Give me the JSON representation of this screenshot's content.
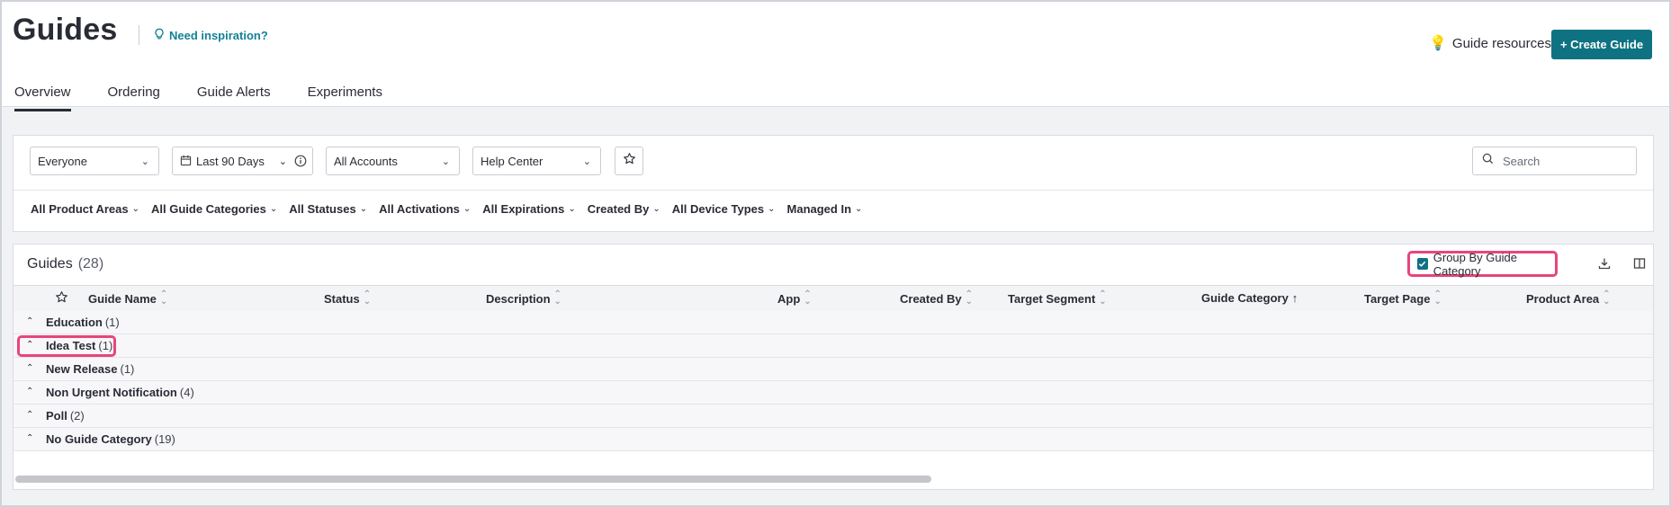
{
  "header": {
    "title": "Guides",
    "inspiration_label": "Need inspiration?",
    "resources_label": "Guide resources",
    "create_button_label": "+ Create Guide"
  },
  "tabs": [
    {
      "label": "Overview",
      "active": true
    },
    {
      "label": "Ordering",
      "active": false
    },
    {
      "label": "Guide Alerts",
      "active": false
    },
    {
      "label": "Experiments",
      "active": false
    }
  ],
  "filters": {
    "segment": "Everyone",
    "date_range": "Last 90 Days",
    "accounts": "All Accounts",
    "app": "Help Center",
    "search_placeholder": "Search",
    "more": [
      "All Product Areas",
      "All Guide Categories",
      "All Statuses",
      "All Activations",
      "All Expirations",
      "Created By",
      "All Device Types",
      "Managed In"
    ]
  },
  "grid": {
    "title": "Guides",
    "count": "(28)",
    "group_by_label": "Group By Guide Category",
    "group_by_checked": true,
    "columns": [
      "Guide Name",
      "Status",
      "Description",
      "App",
      "Created By",
      "Target Segment",
      "Guide Category",
      "Target Page",
      "Product Area"
    ],
    "groups": [
      {
        "name": "Education",
        "count": "(1)"
      },
      {
        "name": "Idea Test",
        "count": "(1)"
      },
      {
        "name": "New Release",
        "count": "(1)"
      },
      {
        "name": "Non Urgent Notification",
        "count": "(4)"
      },
      {
        "name": "Poll",
        "count": "(2)"
      },
      {
        "name": "No Guide Category",
        "count": "(19)"
      }
    ]
  },
  "colors": {
    "accent": "#0e7282",
    "link": "#128297",
    "highlight": "#e8457a"
  }
}
